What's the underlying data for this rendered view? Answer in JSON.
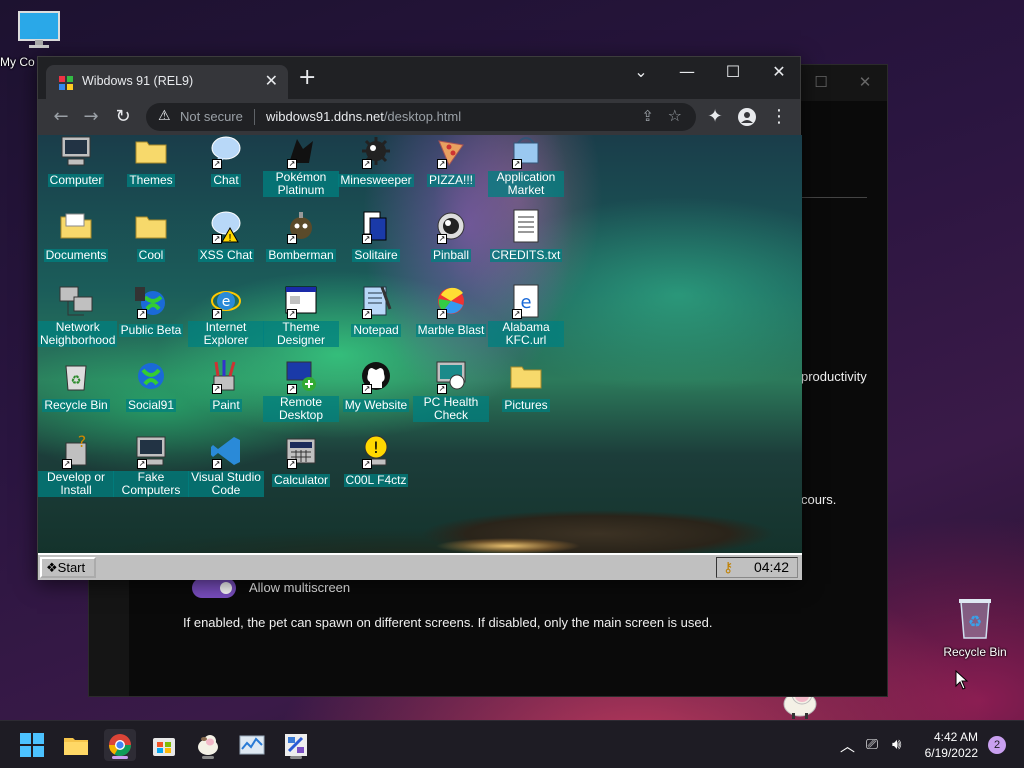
{
  "desktop": {
    "my_computer_label": "My Co",
    "recycle_bin_label": "Recycle Bin"
  },
  "bg_window": {
    "text_productivity": "productivity",
    "text_cours": "cours.",
    "toggle_label": "Allow multiscreen",
    "description": "If enabled, the pet can spawn on different screens. If disabled, only the main screen is used."
  },
  "browser": {
    "tab_title": "Wibdows 91 (REL9)",
    "security_label": "Not secure",
    "url_host": "wibdows91.ddns.net",
    "url_path": "/desktop.html"
  },
  "w91": {
    "icons": [
      {
        "label": "Computer"
      },
      {
        "label": "Themes"
      },
      {
        "label": "Chat"
      },
      {
        "label": "Pokémon Platinum"
      },
      {
        "label": "Minesweeper"
      },
      {
        "label": "PIZZA!!!"
      },
      {
        "label": "Application Market"
      },
      {
        "label": "Documents"
      },
      {
        "label": "Cool"
      },
      {
        "label": "XSS Chat"
      },
      {
        "label": "Bomberman"
      },
      {
        "label": "Solitaire"
      },
      {
        "label": "Pinball"
      },
      {
        "label": "CREDITS.txt"
      },
      {
        "label": "Network Neighborhood"
      },
      {
        "label": "Public Beta"
      },
      {
        "label": "Internet Explorer"
      },
      {
        "label": "Theme Designer"
      },
      {
        "label": "Notepad"
      },
      {
        "label": "Marble Blast"
      },
      {
        "label": "Alabama KFC.url"
      },
      {
        "label": "Recycle Bin"
      },
      {
        "label": "Social91"
      },
      {
        "label": "Paint"
      },
      {
        "label": "Remote Desktop"
      },
      {
        "label": "My Website"
      },
      {
        "label": "PC Health Check"
      },
      {
        "label": "Pictures"
      },
      {
        "label": "Develop or Install"
      },
      {
        "label": "Fake Computers"
      },
      {
        "label": "Visual Studio Code"
      },
      {
        "label": "Calculator"
      },
      {
        "label": "C00L F4ctz"
      }
    ],
    "start_label": "Start",
    "clock": "04:42"
  },
  "taskbar": {
    "time": "4:42 AM",
    "date": "6/19/2022",
    "notification_count": "2"
  }
}
